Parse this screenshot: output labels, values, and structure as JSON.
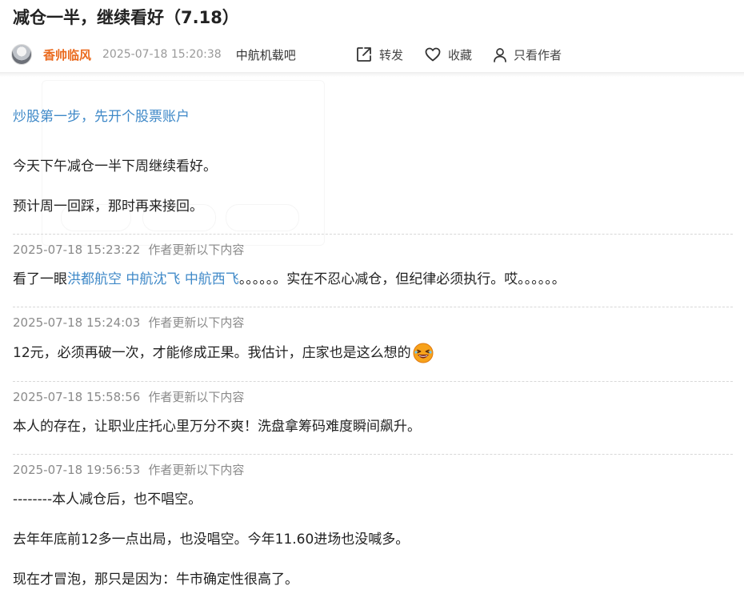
{
  "post": {
    "title": "减仓一半，继续看好（7.18）",
    "author": "香帅临风",
    "time": "2025-07-18 15:20:38",
    "bar": "中航机载吧"
  },
  "actions": {
    "share": "转发",
    "favorite": "收藏",
    "author_only": "只看作者"
  },
  "icons": {
    "share": "share-out-icon",
    "favorite": "heart-icon",
    "author_only": "user-icon",
    "emoji": "laughing-emoji-icon"
  },
  "colors": {
    "author": "#ea6a1e",
    "link": "#3f89c8",
    "meta": "#999999"
  },
  "content": {
    "promo_link": "炒股第一步，先开个股票账户",
    "paragraphs": [
      "今天下午减仓一半下周继续看好。",
      "预计周一回踩，那时再来接回。"
    ]
  },
  "updates": [
    {
      "time": "2025-07-18 15:23:22",
      "label": "作者更新以下内容",
      "text_before": "看了一眼",
      "stock1": "洪都航空",
      "stock2": "中航沈飞",
      "stock3": "中航西飞",
      "text_after": "。。。。。。实在不忍心减仓，但纪律必须执行。哎。。。。。。"
    },
    {
      "time": "2025-07-18 15:24:03",
      "label": "作者更新以下内容",
      "text": "12元，必须再破一次，才能修成正果。我估计，庄家也是这么想的"
    },
    {
      "time": "2025-07-18 15:58:56",
      "label": "作者更新以下内容",
      "text": "本人的存在，让职业庄托心里万分不爽！洗盘拿筹码难度瞬间飙升。"
    },
    {
      "time": "2025-07-18 19:56:53",
      "label": "作者更新以下内容",
      "lines": [
        "--------本人减仓后，也不唱空。",
        "去年年底前12多一点出局，也没唱空。今年11.60进场也没喊多。",
        "现在才冒泡，那只是因为：牛市确定性很高了。"
      ]
    }
  ]
}
